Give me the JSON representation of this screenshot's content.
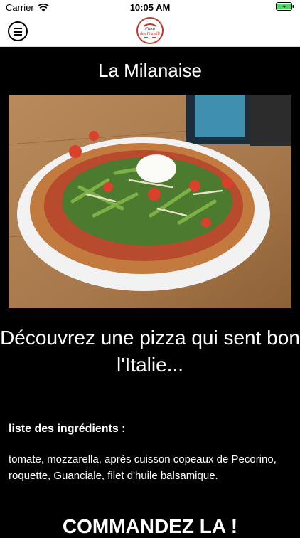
{
  "status": {
    "carrier": "Carrier",
    "time": "10:05 AM"
  },
  "nav": {
    "logo_text": "Pizza des Fratelli"
  },
  "product": {
    "title": "La Milanaise",
    "tagline": "Découvrez une pizza qui sent bon l'Italie...",
    "ingredients_heading": "liste des ingrédients :",
    "ingredients": "tomate, mozzarella, après cuisson copeaux de Pecorino, roquette, Guanciale, filet d'huile balsamique.",
    "order_button": "COMMANDEZ LA !"
  },
  "colors": {
    "background": "#000000",
    "text": "#ffffff",
    "battery": "#4cd964"
  }
}
